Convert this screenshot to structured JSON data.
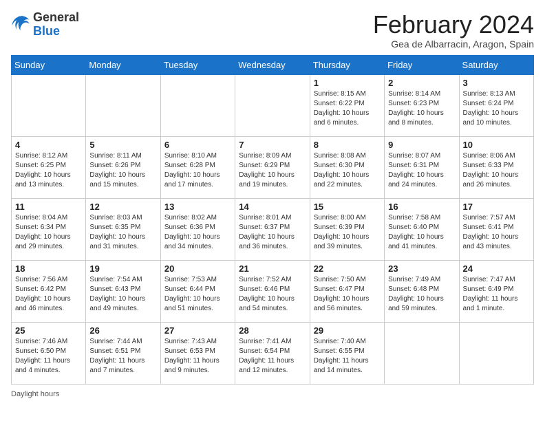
{
  "header": {
    "logo_general": "General",
    "logo_blue": "Blue",
    "title": "February 2024",
    "subtitle": "Gea de Albarracin, Aragon, Spain"
  },
  "days_of_week": [
    "Sunday",
    "Monday",
    "Tuesday",
    "Wednesday",
    "Thursday",
    "Friday",
    "Saturday"
  ],
  "weeks": [
    [
      {
        "day": "",
        "info": ""
      },
      {
        "day": "",
        "info": ""
      },
      {
        "day": "",
        "info": ""
      },
      {
        "day": "",
        "info": ""
      },
      {
        "day": "1",
        "info": "Sunrise: 8:15 AM\nSunset: 6:22 PM\nDaylight: 10 hours and 6 minutes."
      },
      {
        "day": "2",
        "info": "Sunrise: 8:14 AM\nSunset: 6:23 PM\nDaylight: 10 hours and 8 minutes."
      },
      {
        "day": "3",
        "info": "Sunrise: 8:13 AM\nSunset: 6:24 PM\nDaylight: 10 hours and 10 minutes."
      }
    ],
    [
      {
        "day": "4",
        "info": "Sunrise: 8:12 AM\nSunset: 6:25 PM\nDaylight: 10 hours and 13 minutes."
      },
      {
        "day": "5",
        "info": "Sunrise: 8:11 AM\nSunset: 6:26 PM\nDaylight: 10 hours and 15 minutes."
      },
      {
        "day": "6",
        "info": "Sunrise: 8:10 AM\nSunset: 6:28 PM\nDaylight: 10 hours and 17 minutes."
      },
      {
        "day": "7",
        "info": "Sunrise: 8:09 AM\nSunset: 6:29 PM\nDaylight: 10 hours and 19 minutes."
      },
      {
        "day": "8",
        "info": "Sunrise: 8:08 AM\nSunset: 6:30 PM\nDaylight: 10 hours and 22 minutes."
      },
      {
        "day": "9",
        "info": "Sunrise: 8:07 AM\nSunset: 6:31 PM\nDaylight: 10 hours and 24 minutes."
      },
      {
        "day": "10",
        "info": "Sunrise: 8:06 AM\nSunset: 6:33 PM\nDaylight: 10 hours and 26 minutes."
      }
    ],
    [
      {
        "day": "11",
        "info": "Sunrise: 8:04 AM\nSunset: 6:34 PM\nDaylight: 10 hours and 29 minutes."
      },
      {
        "day": "12",
        "info": "Sunrise: 8:03 AM\nSunset: 6:35 PM\nDaylight: 10 hours and 31 minutes."
      },
      {
        "day": "13",
        "info": "Sunrise: 8:02 AM\nSunset: 6:36 PM\nDaylight: 10 hours and 34 minutes."
      },
      {
        "day": "14",
        "info": "Sunrise: 8:01 AM\nSunset: 6:37 PM\nDaylight: 10 hours and 36 minutes."
      },
      {
        "day": "15",
        "info": "Sunrise: 8:00 AM\nSunset: 6:39 PM\nDaylight: 10 hours and 39 minutes."
      },
      {
        "day": "16",
        "info": "Sunrise: 7:58 AM\nSunset: 6:40 PM\nDaylight: 10 hours and 41 minutes."
      },
      {
        "day": "17",
        "info": "Sunrise: 7:57 AM\nSunset: 6:41 PM\nDaylight: 10 hours and 43 minutes."
      }
    ],
    [
      {
        "day": "18",
        "info": "Sunrise: 7:56 AM\nSunset: 6:42 PM\nDaylight: 10 hours and 46 minutes."
      },
      {
        "day": "19",
        "info": "Sunrise: 7:54 AM\nSunset: 6:43 PM\nDaylight: 10 hours and 49 minutes."
      },
      {
        "day": "20",
        "info": "Sunrise: 7:53 AM\nSunset: 6:44 PM\nDaylight: 10 hours and 51 minutes."
      },
      {
        "day": "21",
        "info": "Sunrise: 7:52 AM\nSunset: 6:46 PM\nDaylight: 10 hours and 54 minutes."
      },
      {
        "day": "22",
        "info": "Sunrise: 7:50 AM\nSunset: 6:47 PM\nDaylight: 10 hours and 56 minutes."
      },
      {
        "day": "23",
        "info": "Sunrise: 7:49 AM\nSunset: 6:48 PM\nDaylight: 10 hours and 59 minutes."
      },
      {
        "day": "24",
        "info": "Sunrise: 7:47 AM\nSunset: 6:49 PM\nDaylight: 11 hours and 1 minute."
      }
    ],
    [
      {
        "day": "25",
        "info": "Sunrise: 7:46 AM\nSunset: 6:50 PM\nDaylight: 11 hours and 4 minutes."
      },
      {
        "day": "26",
        "info": "Sunrise: 7:44 AM\nSunset: 6:51 PM\nDaylight: 11 hours and 7 minutes."
      },
      {
        "day": "27",
        "info": "Sunrise: 7:43 AM\nSunset: 6:53 PM\nDaylight: 11 hours and 9 minutes."
      },
      {
        "day": "28",
        "info": "Sunrise: 7:41 AM\nSunset: 6:54 PM\nDaylight: 11 hours and 12 minutes."
      },
      {
        "day": "29",
        "info": "Sunrise: 7:40 AM\nSunset: 6:55 PM\nDaylight: 11 hours and 14 minutes."
      },
      {
        "day": "",
        "info": ""
      },
      {
        "day": "",
        "info": ""
      }
    ]
  ],
  "footer": {
    "daylight_label": "Daylight hours"
  }
}
